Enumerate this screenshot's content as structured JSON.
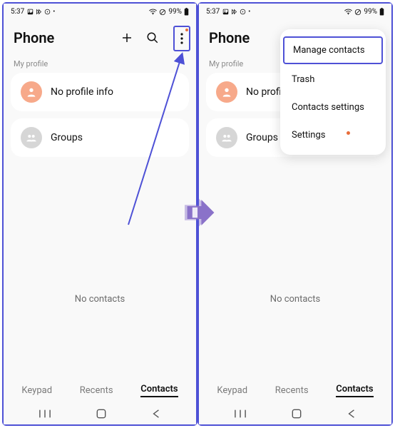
{
  "status": {
    "time": "5:37",
    "battery": "99%"
  },
  "header": {
    "title": "Phone"
  },
  "sections": {
    "my_profile": "My profile",
    "no_profile": "No profile info",
    "no_profile_trunc": "No profile info",
    "groups": "Groups"
  },
  "empty_text": "No contacts",
  "tabs": {
    "keypad": "Keypad",
    "recents": "Recents",
    "contacts": "Contacts"
  },
  "menu": {
    "manage": "Manage contacts",
    "trash": "Trash",
    "settings": "Contacts settings",
    "more_settings": "Settings"
  }
}
